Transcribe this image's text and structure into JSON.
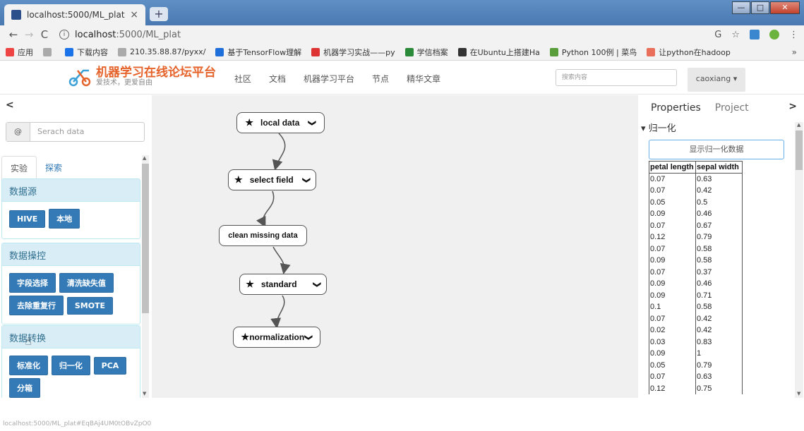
{
  "browser": {
    "tab_title": "localhost:5000/ML_plat",
    "tab_close": "×",
    "new_tab": "+",
    "back": "←",
    "forward": "→",
    "reload": "C",
    "url_host": "localhost",
    "url_path": ":5000/ML_plat",
    "translate_icon": "G",
    "star_icon": "☆",
    "menu_icon": "⋮",
    "win_min": "—",
    "win_max": "□",
    "win_close": "✕"
  },
  "bookmarks": [
    {
      "label": "应用",
      "icon": "apps-icon",
      "color": "#e44"
    },
    {
      "label": "",
      "icon": "file-icon",
      "color": "#aaa"
    },
    {
      "label": "下载内容",
      "icon": "download-icon",
      "color": "#1a73e8"
    },
    {
      "label": "210.35.88.87/pyxx/",
      "icon": "page-icon",
      "color": "#aaa"
    },
    {
      "label": "基于TensorFlow理解",
      "icon": "zhihu-icon",
      "color": "#1e6fd9"
    },
    {
      "label": "机器学习实战——py",
      "icon": "csdn-icon",
      "color": "#d33"
    },
    {
      "label": "学信档案",
      "icon": "xuexin-icon",
      "color": "#2a8a3a"
    },
    {
      "label": "在Ubuntu上搭建Ha",
      "icon": "linux-icon",
      "color": "#333"
    },
    {
      "label": "Python 100例 | 菜鸟",
      "icon": "runoob-icon",
      "color": "#5a9e3c"
    },
    {
      "label": "让python在hadoop",
      "icon": "jianshu-icon",
      "color": "#ea6f5a"
    }
  ],
  "bookmarks_more": "»",
  "site": {
    "title": "机器学习在线论坛平台",
    "subtitle": "爱技术，更爱自由",
    "nav": [
      "社区",
      "文档",
      "机器学习平台",
      "节点",
      "精华文章"
    ],
    "search_placeholder": "搜索内容",
    "user": "caoxiang ▾"
  },
  "left_panel": {
    "collapse": "<",
    "search_addon": "@",
    "search_placeholder": "Serach data",
    "tabs": [
      "实验",
      "探索"
    ],
    "groups": [
      {
        "title": "数据源",
        "buttons": [
          "HIVE",
          "本地"
        ]
      },
      {
        "title": "数据操控",
        "buttons": [
          "字段选择",
          "清洗缺失值",
          "去除重复行",
          "SMOTE"
        ]
      },
      {
        "title": "数据转换",
        "buttons": [
          "标准化",
          "归一化",
          "PCA",
          "分箱"
        ]
      }
    ]
  },
  "flow": {
    "nodes": [
      {
        "label": "local data",
        "star": "★",
        "caret": "❯"
      },
      {
        "label": "select field",
        "star": "★",
        "caret": "❯"
      },
      {
        "label": "clean missing data",
        "star": "★",
        "caret": "❯"
      },
      {
        "label": "standard",
        "star": "★",
        "caret": "❯"
      },
      {
        "label": "normalization",
        "star": "★",
        "caret": "❯"
      }
    ]
  },
  "right_panel": {
    "tabs": [
      "Properties",
      "Project"
    ],
    "collapse": ">",
    "section": "▾ 归一化",
    "show_button": "显示归一化数据",
    "columns": [
      "petal length",
      "sepal width"
    ],
    "rows": [
      [
        "0.07",
        "0.63"
      ],
      [
        "0.07",
        "0.42"
      ],
      [
        "0.05",
        "0.5"
      ],
      [
        "0.09",
        "0.46"
      ],
      [
        "0.07",
        "0.67"
      ],
      [
        "0.12",
        "0.79"
      ],
      [
        "0.07",
        "0.58"
      ],
      [
        "0.09",
        "0.58"
      ],
      [
        "0.07",
        "0.37"
      ],
      [
        "0.09",
        "0.46"
      ],
      [
        "0.09",
        "0.71"
      ],
      [
        "0.1",
        "0.58"
      ],
      [
        "0.07",
        "0.42"
      ],
      [
        "0.02",
        "0.42"
      ],
      [
        "0.03",
        "0.83"
      ],
      [
        "0.09",
        "1"
      ],
      [
        "0.05",
        "0.79"
      ],
      [
        "0.07",
        "0.63"
      ],
      [
        "0.12",
        "0.75"
      ]
    ]
  },
  "status_url": "localhost:5000/ML_plat#EqBAj4UM0tOBvZpO0"
}
